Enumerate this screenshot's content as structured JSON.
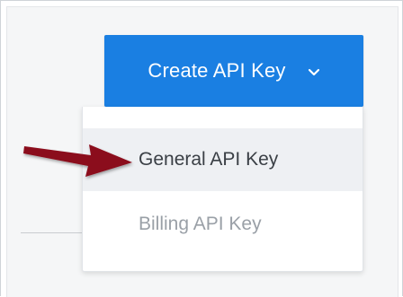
{
  "toolbar": {
    "create_label": "Create API Key"
  },
  "dropdown": {
    "items": [
      {
        "label": "General API Key",
        "state": "highlighted"
      },
      {
        "label": "Billing API Key",
        "state": "default"
      }
    ]
  },
  "icons": {
    "chevron": "chevron-down-icon",
    "annotation": "arrow-pointer-icon"
  },
  "colors": {
    "accent": "#1a7fe2",
    "arrow": "#8b0a1a",
    "menu_highlight": "#eef0f3"
  }
}
